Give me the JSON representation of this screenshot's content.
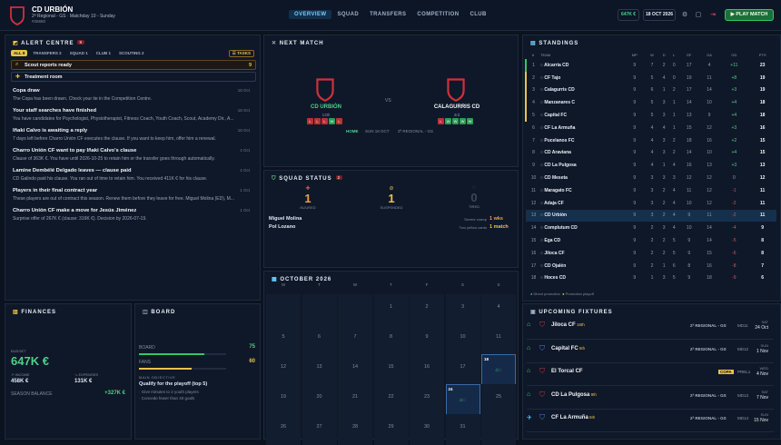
{
  "header": {
    "club": "CD URBIÓN",
    "subtitle": "2ª Regional - GS · Matchday 10 - Sunday",
    "club_id": "#26650",
    "nav": [
      "OVERVIEW",
      "SQUAD",
      "TRANSFERS",
      "COMPETITION",
      "CLUB"
    ],
    "budget_pill": "647K €",
    "date_pill": "18 OCT 2026",
    "play": "PLAY MATCH"
  },
  "alerts": {
    "title": "ALERT CENTRE",
    "count": "9",
    "tabs": [
      "ALL 9",
      "TRANSFERS 2",
      "SQUAD 1",
      "CLUB 1",
      "SCOUTING 2"
    ],
    "tasks": "TASKS",
    "scout": "Scout reports ready",
    "scout_count": "9",
    "treatment": "Treatment room",
    "items": [
      {
        "title": "Copa draw",
        "desc": "The Copa has been drawn. Check your tie in the Competition Centre.",
        "date": "18 Oct"
      },
      {
        "title": "Your staff searches have finished",
        "desc": "You have candidates for Psychologist, Physiotherapist, Fitness Coach, Youth Coach, Scout, Academy Dir., A...",
        "date": "18 Oct"
      },
      {
        "title": "Iñaki Calvo is awaiting a reply",
        "desc": "7 days left before Charro Unión CF executes the clause. If you want to keep him, offer him a renewal.",
        "date": "18 Oct"
      },
      {
        "title": "Charro Unión CF want to pay Iñaki Calvo's clause",
        "desc": "Clause of 363K €. You have until 2026-10-25 to retain him or the transfer goes through automatically.",
        "date": "4 Oct"
      },
      {
        "title": "Lamine Dembélé Delgado leaves — clause paid",
        "desc": "CD Galindo paid his clause. You ran out of time to retain him. You received 411K € for his clause.",
        "date": "4 Oct"
      },
      {
        "title": "Players in their final contract year",
        "desc": "These players are out of contract this season. Renew them before they leave for free. Miguel Molina (ED), M...",
        "date": "1 Oct"
      },
      {
        "title": "Charro Unión CF make a move for Jesús Jiménez",
        "desc": "Surprise offer of 267K € (clause: 316K €). Decision by 2026-07-19.",
        "date": "1 Oct"
      }
    ]
  },
  "next_match": {
    "title": "NEXT MATCH",
    "home": "CD URBIÓN",
    "home_pos": "13th",
    "away": "CALAGURRIS CD",
    "away_pos": "3rd",
    "vs": "VS",
    "home_form": [
      "L",
      "L",
      "L",
      "W",
      "L"
    ],
    "away_form": [
      "L",
      "W",
      "W",
      "W",
      "W"
    ],
    "venue": "HOME",
    "date": "SUN 18 OCT",
    "comp": "2ª REGIONAL - GS"
  },
  "squad": {
    "title": "SQUAD STATUS",
    "count": "2",
    "injured": "1",
    "injured_label": "INJURED",
    "susp": "1",
    "susp_label": "SUSPENDED",
    "tired": "0",
    "tired_label": "TIRED",
    "p1": "Miguel Molina",
    "p1_note": "Severe cramp",
    "p1_val": "1 wks",
    "p2": "Pol Lozano",
    "p2_note": "Two yellow cards",
    "p2_val": "1 match"
  },
  "standings": {
    "title": "STANDINGS",
    "headers": [
      "#",
      "TEAM",
      "MP",
      "W",
      "D",
      "L",
      "GF",
      "GA",
      "GD",
      "PTS"
    ],
    "rows": [
      [
        "1",
        "Alcarria CD",
        "9",
        "7",
        "2",
        "0",
        "17",
        "4",
        "+11",
        "23"
      ],
      [
        "2",
        "CF Tajo",
        "9",
        "5",
        "4",
        "0",
        "19",
        "11",
        "+8",
        "19"
      ],
      [
        "3",
        "Calagurris CD",
        "9",
        "6",
        "1",
        "2",
        "17",
        "14",
        "+3",
        "19"
      ],
      [
        "4",
        "Manzanares C",
        "9",
        "5",
        "3",
        "1",
        "14",
        "10",
        "+4",
        "18"
      ],
      [
        "5",
        "Capital FC",
        "9",
        "5",
        "3",
        "1",
        "13",
        "9",
        "+4",
        "18"
      ],
      [
        "6",
        "CF La Armuña",
        "9",
        "4",
        "4",
        "1",
        "15",
        "12",
        "+3",
        "16"
      ],
      [
        "7",
        "Pucelanos FC",
        "9",
        "4",
        "3",
        "2",
        "18",
        "16",
        "+2",
        "15"
      ],
      [
        "8",
        "CD Araviana",
        "9",
        "4",
        "3",
        "2",
        "14",
        "10",
        "+4",
        "15"
      ],
      [
        "9",
        "CD La Pulgosa",
        "9",
        "4",
        "1",
        "4",
        "16",
        "13",
        "+3",
        "13"
      ],
      [
        "10",
        "CD Meseta",
        "9",
        "3",
        "3",
        "3",
        "12",
        "12",
        "0",
        "12"
      ],
      [
        "11",
        "Maragato FC",
        "9",
        "3",
        "2",
        "4",
        "11",
        "12",
        "-1",
        "11"
      ],
      [
        "12",
        "Adaja CF",
        "9",
        "3",
        "2",
        "4",
        "10",
        "12",
        "-2",
        "11"
      ],
      [
        "13",
        "CD Urbión",
        "9",
        "3",
        "2",
        "4",
        "9",
        "11",
        "-2",
        "11"
      ],
      [
        "14",
        "Complutum CD",
        "9",
        "2",
        "3",
        "4",
        "10",
        "14",
        "-4",
        "9"
      ],
      [
        "15",
        "Ega CD",
        "9",
        "2",
        "2",
        "5",
        "9",
        "14",
        "-5",
        "8"
      ],
      [
        "16",
        "Jiloca CF",
        "9",
        "2",
        "2",
        "5",
        "9",
        "15",
        "-6",
        "8"
      ],
      [
        "17",
        "CD Ojalén",
        "9",
        "2",
        "1",
        "6",
        "8",
        "16",
        "-8",
        "7"
      ],
      [
        "18",
        "Hoces CD",
        "9",
        "1",
        "3",
        "5",
        "9",
        "18",
        "-9",
        "6"
      ]
    ],
    "legend1": "Direct promotion",
    "legend2": "Promotion playoff"
  },
  "finances": {
    "title": "FINANCES",
    "budget_label": "BUDGET",
    "budget": "647K €",
    "income_label": "INCOME",
    "income": "458K €",
    "exp_label": "EXPENSES",
    "expenses": "131K €",
    "balance_label": "SEASON BALANCE",
    "balance": "+327K €"
  },
  "board": {
    "title": "BOARD",
    "board_label": "BOARD",
    "board_val": "75",
    "board_level": 0.75,
    "fans_label": "FANS",
    "fans_val": "60",
    "fans_level": 0.6,
    "obj_label": "MAIN OBJECTIVE",
    "obj": "Qualify for the playoff (top 5)",
    "obj_l1": "Give minutes to 2 youth players",
    "obj_l2": "Concede fewer than 40 goals"
  },
  "calendar": {
    "title": "OCTOBER 2026",
    "days": [
      "M",
      "T",
      "W",
      "T",
      "F",
      "S",
      "S"
    ],
    "weeks": [
      [
        "",
        "",
        "",
        "1",
        "2",
        "3",
        "4"
      ],
      [
        "5",
        "6",
        "7",
        "8",
        "9",
        "10",
        "11"
      ],
      [
        "12",
        "13",
        "14",
        "15",
        "16",
        "17",
        "18"
      ],
      [
        "19",
        "20",
        "21",
        "22",
        "23",
        "24",
        "25"
      ],
      [
        "26",
        "27",
        "28",
        "29",
        "30",
        "31",
        ""
      ]
    ]
  },
  "fixtures": {
    "title": "UPCOMING FIXTURES",
    "items": [
      {
        "team": "Jiloca CF",
        "pos": "16th",
        "comp": "2ª REGIONAL - GS",
        "md": "MD11",
        "day": "SAT",
        "date": "24 Oct"
      },
      {
        "team": "Capital FC",
        "pos": "5th",
        "comp": "2ª REGIONAL - GS",
        "md": "MD12",
        "day": "SUN",
        "date": "1 Nov"
      },
      {
        "team": "El Torcal CF",
        "pos": "",
        "comp": "COPA",
        "md": "PREL1",
        "day": "WED",
        "date": "4 Nov"
      },
      {
        "team": "CD La Pulgosa",
        "pos": "9th",
        "comp": "2ª REGIONAL - GS",
        "md": "MD13",
        "day": "SAT",
        "date": "7 Nov"
      },
      {
        "team": "CF La Armuña",
        "pos": "6th",
        "comp": "2ª REGIONAL - GS",
        "md": "MD14",
        "day": "SUN",
        "date": "15 Nov"
      }
    ]
  }
}
